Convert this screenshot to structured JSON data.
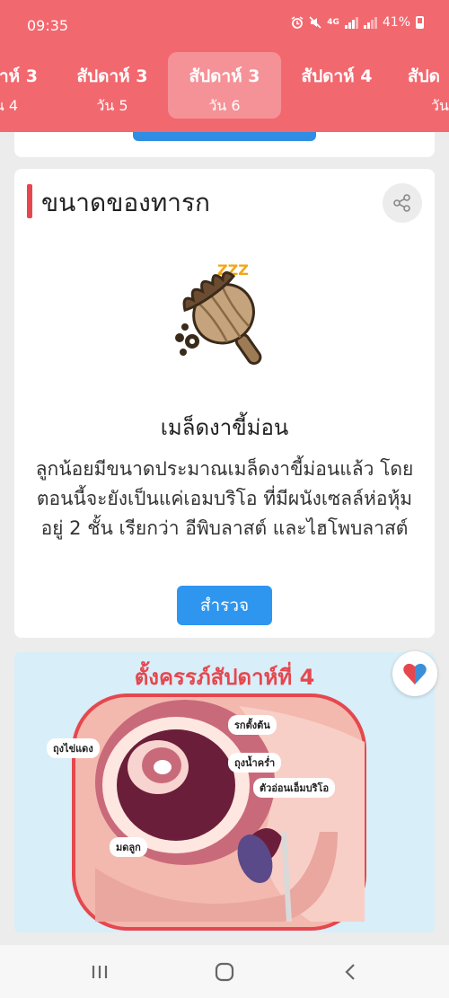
{
  "status_bar": {
    "time": "09:35",
    "network": "4G",
    "battery": "41%"
  },
  "tabs": [
    {
      "week": "าห์ 3",
      "day": "น 4"
    },
    {
      "week": "สัปดาห์ 3",
      "day": "วัน 5"
    },
    {
      "week": "สัปดาห์ 3",
      "day": "วัน 6",
      "active": true
    },
    {
      "week": "สัปดาห์ 4",
      "day": ""
    },
    {
      "week": "สัปด",
      "day": "วัน"
    }
  ],
  "baby_size": {
    "title": "ขนาดของทารก",
    "zzz": "ZZZ",
    "item_name": "เมล็ดงาขี้ม่อน",
    "description": "ลูกน้อยมีขนาดประมาณเมล็ดงาขี้ม่อนแล้ว โดยตอนนี้จะยังเป็นแค่เอมบริโอ ที่มีผนังเซลล์ห่อหุ้มอยู่ 2 ชั้น เรียกว่า อีพิบลาสต์ และไฮโพบลาสต์",
    "explore_label": "สำรวจ"
  },
  "week_image": {
    "title": "ตั้งครรภ์สัปดาห์ที่ 4",
    "labels": {
      "placenta": "รกตั้งต้น",
      "yolk_sac": "ถุงไข่แดง",
      "amniotic_sac": "ถุงน้ำคร่ำ",
      "embryo": "ตัวอ่อนเอ็มบริโอ",
      "uterus": "มดลูก"
    }
  },
  "colors": {
    "header": "#f2686f",
    "accent": "#e6474e",
    "button": "#2f96ef"
  },
  "icons": [
    "alarm-icon",
    "mute-icon",
    "signal-icon",
    "battery-icon",
    "share-icon",
    "heart-icon",
    "recent-apps-icon",
    "home-icon",
    "back-icon"
  ]
}
